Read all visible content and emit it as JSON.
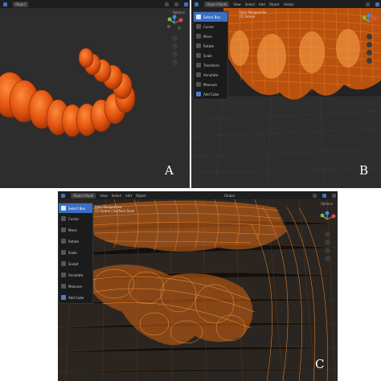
{
  "panels": {
    "a": {
      "letter": "A",
      "header": {
        "mode": "Object",
        "view_label": "Options"
      },
      "render": "solid orange dental arch model"
    },
    "b": {
      "letter": "B",
      "header": {
        "mode": "Object Mode",
        "menus": [
          "View",
          "Select",
          "Add",
          "Object"
        ],
        "view_label": "Global"
      },
      "overlay": [
        "User Perspective",
        "(1) Scene"
      ],
      "tools": [
        "Select Box",
        "Cursor",
        "Move",
        "Rotate",
        "Scale",
        "Transform",
        "Annotate",
        "Measure",
        "Add Cube"
      ]
    },
    "c": {
      "letter": "C",
      "header": {
        "mode": "Object Mode",
        "menus": [
          "View",
          "Select",
          "Add",
          "Object"
        ],
        "view_label": "Global",
        "options": "Options"
      },
      "overlay": [
        "User Perspective",
        "(1) Scene | Surface Scan"
      ],
      "tools": [
        "Select Box",
        "Cursor",
        "Move",
        "Rotate",
        "Scale",
        "Sculpt",
        "Annotate",
        "Measure",
        "Add Cube"
      ]
    }
  },
  "colors": {
    "accent": "#3a6fc2",
    "mesh": "#ff7a1a",
    "model": "#e85a14",
    "viewport": "#2b2b2b"
  },
  "icons": [
    "gizmo-icon",
    "zoom-icon",
    "hand-icon",
    "camera-icon",
    "grid-icon"
  ]
}
